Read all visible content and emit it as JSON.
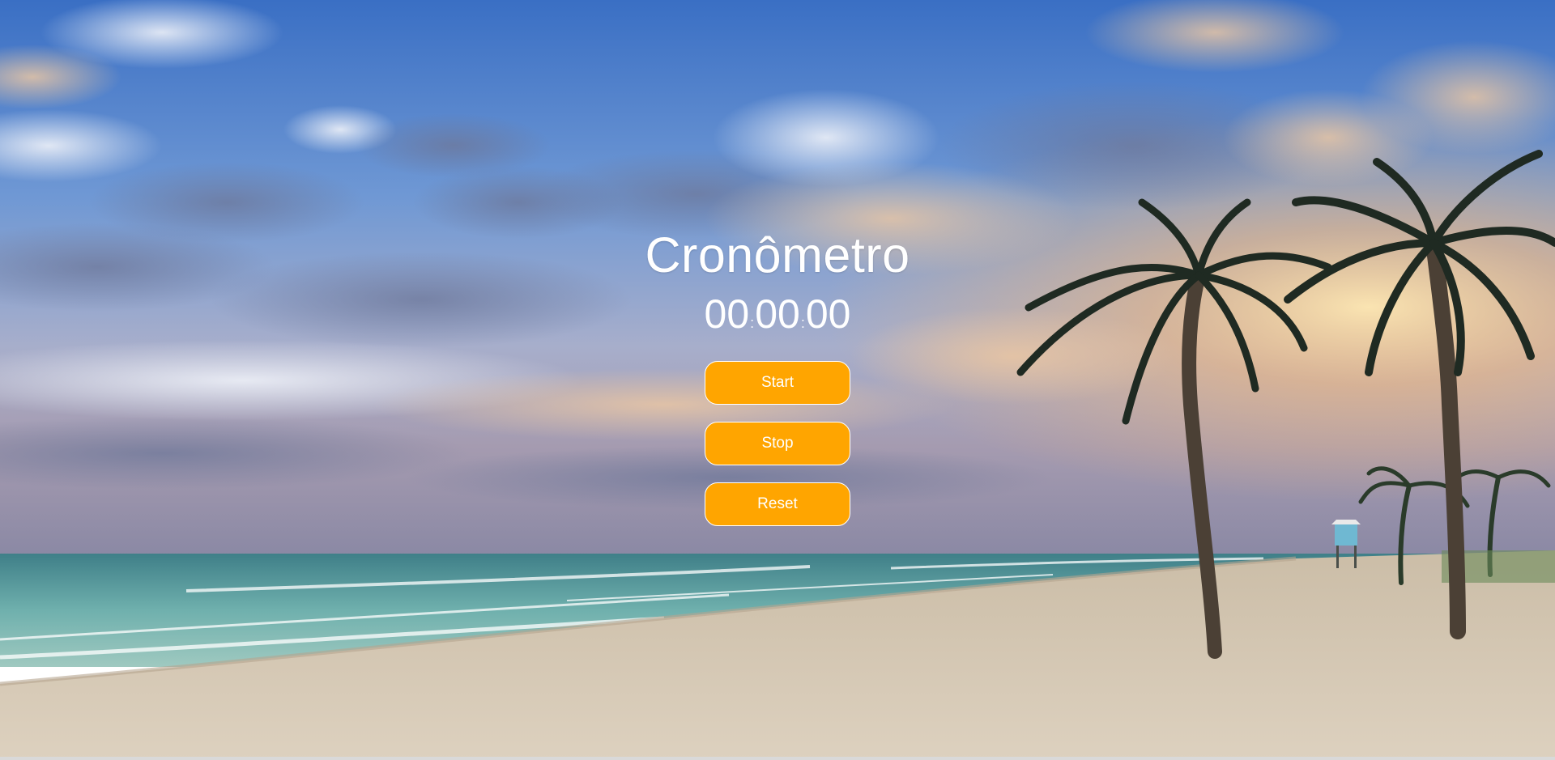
{
  "background": {
    "icon": "beach-palm-sunset-image",
    "colors": {
      "sky_top": "#3d74c7",
      "sky_mid": "#86a7d6",
      "sky_horizon": "#f2c38a",
      "sea": "#5aa6a6",
      "sand": "#d8cbb8",
      "palm": "#1f2a22"
    }
  },
  "stopwatch": {
    "title": "Cronômetro",
    "hours": "00",
    "minutes": "00",
    "seconds": "00",
    "separator": ":",
    "start_label": "Start",
    "stop_label": "Stop",
    "reset_label": "Reset",
    "button_color": "#ffa500"
  }
}
